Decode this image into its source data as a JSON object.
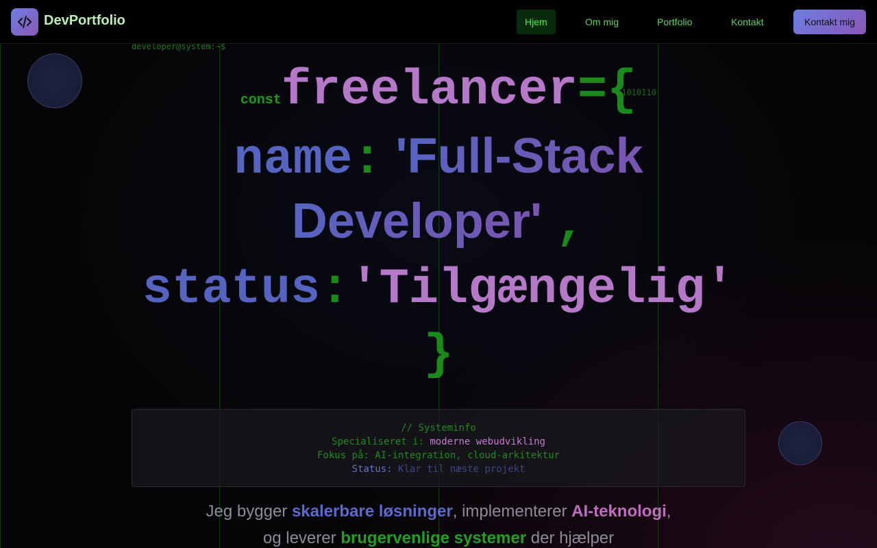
{
  "nav": {
    "brand": "DevPortfolio",
    "links": [
      {
        "label": "Hjem",
        "active": true
      },
      {
        "label": "Om mig",
        "active": false
      },
      {
        "label": "Portfolio",
        "active": false
      },
      {
        "label": "Kontakt",
        "active": false
      }
    ],
    "cta_label": "Kontakt mig",
    "logo_icon": "code-icon"
  },
  "hero": {
    "prompt": "developer@system:~$",
    "binary": "11010110",
    "code": {
      "keyword": "const",
      "var_name": "freelancer",
      "assign_open": "={",
      "name_key": "name",
      "colon": ":",
      "name_value_line1": "'Full-Stack",
      "name_value_line2": "Developer'",
      "comma": ",",
      "status_key": "status",
      "status_value": "'Tilgængelig'",
      "close": "}"
    }
  },
  "sysinfo": {
    "comment": "// Systeminfo",
    "specialized_label": "Specialiseret i:",
    "specialized_value": "moderne webudvikling",
    "focus_line": "Fokus på: AI-integration, cloud-arkitektur",
    "status_label": "Status:",
    "status_value": "Klar til næste projekt"
  },
  "tagline": {
    "part1": "Jeg bygger ",
    "highlight1": "skalerbare løsninger",
    "part2": ", implementerer ",
    "highlight2": "AI-teknologi",
    "part3": ", og leverer ",
    "highlight3": "brugervenlige systemer",
    "part4": " der hjælper"
  },
  "colors": {
    "accent_green": "#1a8a1a",
    "accent_purple": "#b678c8",
    "accent_blue": "#5564c0",
    "button_gradient_start": "#6b7fe0",
    "button_gradient_end": "#8a56b8"
  }
}
